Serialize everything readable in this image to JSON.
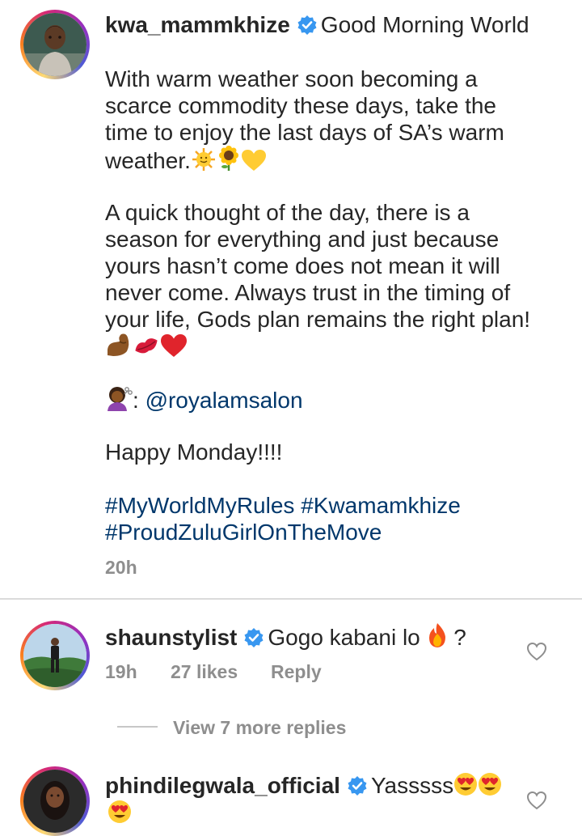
{
  "post": {
    "username": "kwa_mammkhize",
    "first_line": "Good Morning World",
    "paragraph1": [
      "With warm weather soon becoming a",
      "scarce commodity these days, take the",
      "time to enjoy the last days of SA’s warm",
      "weather."
    ],
    "paragraph2": [
      "A quick thought of the day, there is a",
      "season for everything and just because",
      "yours hasn’t come does not mean it will",
      "never come. Always trust in the timing of",
      "your life, Gods plan remains the right plan!"
    ],
    "credit_prefix": ": ",
    "mention": "@royalamsalon",
    "greeting": "Happy Monday!!!!",
    "hashtags": [
      "#MyWorldMyRules",
      "#Kwamamkhize",
      "#ProudZuluGirlOnTheMove"
    ],
    "time": "20h"
  },
  "comments": [
    {
      "username": "shaunstylist",
      "text": "Gogo kabani lo",
      "text_suffix": " ?",
      "time": "19h",
      "likes": "27 likes",
      "reply": "Reply"
    },
    {
      "username": "phindilegwala_official",
      "text": "Yasssss"
    }
  ],
  "view_replies": "View 7 more replies",
  "icons": {
    "verified": "verified-badge-icon",
    "like": "heart-outline-icon"
  },
  "colors": {
    "hashtag": "#00376b",
    "verified": "#3897f0",
    "meta": "#8e8e8e"
  }
}
